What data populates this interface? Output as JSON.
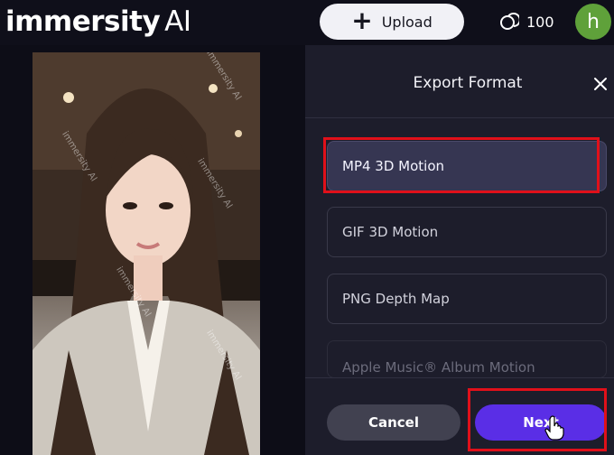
{
  "header": {
    "logo_main": "immersity",
    "logo_ai": "AI",
    "upload_label": "Upload",
    "credits": "100",
    "avatar_initial": "h"
  },
  "preview": {
    "watermark": "immersity AI"
  },
  "panel": {
    "title": "Export Format",
    "options": [
      {
        "label": "MP4 3D Motion",
        "selected": true
      },
      {
        "label": "GIF 3D Motion",
        "selected": false
      },
      {
        "label": "PNG Depth Map",
        "selected": false
      },
      {
        "label": "Apple Music® Album Motion",
        "selected": false
      }
    ],
    "cancel_label": "Cancel",
    "next_label": "Next"
  },
  "colors": {
    "accent": "#5a2ee6",
    "highlight": "#e0101a",
    "avatar": "#5fa13a"
  }
}
